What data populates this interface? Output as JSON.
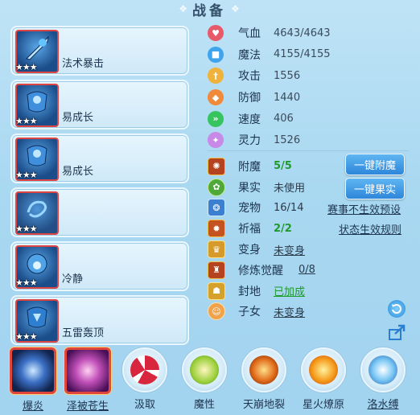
{
  "title": "战备",
  "equipment": [
    {
      "name": "法术暴击",
      "stars": "★★★"
    },
    {
      "name": "易成长",
      "stars": "★★★"
    },
    {
      "name": "易成长",
      "stars": "★★★"
    },
    {
      "name": "",
      "stars": "★★★"
    },
    {
      "name": "冷静",
      "stars": "★★★"
    },
    {
      "name": "五雷轰顶",
      "stars": "★★★"
    }
  ],
  "stats": [
    {
      "label": "气血",
      "value": "4643/4643",
      "icon": "heart-icon",
      "color": "#e8596a"
    },
    {
      "label": "魔法",
      "value": "4155/4155",
      "icon": "mana-icon",
      "color": "#3fa4ec"
    },
    {
      "label": "攻击",
      "value": "1556",
      "icon": "attack-icon",
      "color": "#f0b23a"
    },
    {
      "label": "防御",
      "value": "1440",
      "icon": "shield-icon",
      "color": "#f08a3a"
    },
    {
      "label": "速度",
      "value": "406",
      "icon": "speed-icon",
      "color": "#36c45e"
    },
    {
      "label": "灵力",
      "value": "1526",
      "icon": "spirit-icon",
      "color": "#c88ae6"
    }
  ],
  "details": [
    {
      "label": "附魔",
      "value": "5/5",
      "icon": "enchant-icon"
    },
    {
      "label": "果实",
      "value": "未使用",
      "icon": "fruit-icon"
    },
    {
      "label": "宠物",
      "value": "16/14",
      "icon": "pet-icon"
    },
    {
      "label": "祈福",
      "value": "2/2",
      "icon": "pray-icon"
    },
    {
      "label": "变身",
      "value": "未变身",
      "icon": "transform-icon"
    },
    {
      "label": "修炼觉醒",
      "value": "0/8",
      "icon": "cultivate-icon"
    },
    {
      "label": "封地",
      "value": "已加成",
      "icon": "fief-icon"
    },
    {
      "label": "子女",
      "value": "未变身",
      "icon": "child-icon"
    }
  ],
  "buttons": {
    "enchant_all": "一键附魔",
    "fruit_all": "一键果实"
  },
  "links": {
    "event_preset": "赛事不生效预设",
    "status_rules": "状态生效规则"
  },
  "skills": [
    {
      "label": "爆炎",
      "icon": "blast-flame-icon"
    },
    {
      "label": "泽被苍生",
      "icon": "bless-all-icon"
    },
    {
      "label": "汲取",
      "icon": "absorb-icon"
    },
    {
      "label": "魔性",
      "icon": "demonic-icon"
    },
    {
      "label": "天崩地裂",
      "icon": "earthquake-icon"
    },
    {
      "label": "星火燎原",
      "icon": "starfire-icon"
    },
    {
      "label": "洛水缚",
      "icon": "water-bind-icon"
    }
  ],
  "side_icons": [
    "refresh-icon",
    "share-icon"
  ]
}
